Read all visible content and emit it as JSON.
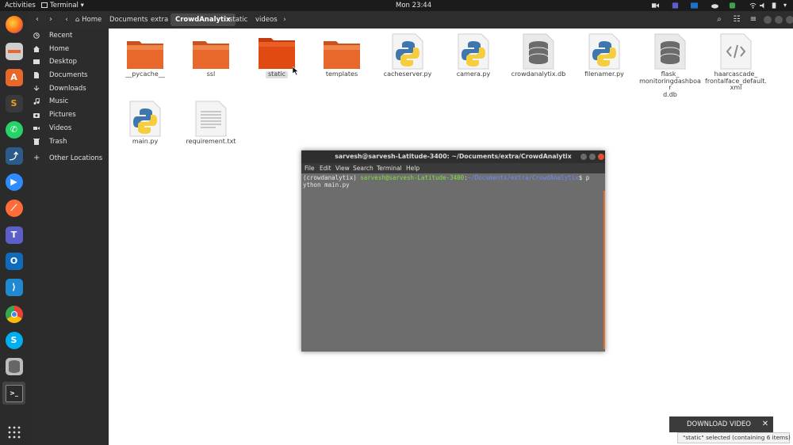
{
  "topbar": {
    "activities": "Activities",
    "app_menu": "Terminal",
    "clock": "Mon 23:44"
  },
  "files": {
    "breadcrumb": [
      "Home",
      "Documents",
      "extra",
      "CrowdAnalytix",
      "static",
      "videos"
    ],
    "sidebar": [
      "Recent",
      "Home",
      "Desktop",
      "Documents",
      "Downloads",
      "Music",
      "Pictures",
      "Videos",
      "Trash",
      "Other Locations"
    ],
    "items": [
      {
        "name": "__pycache__",
        "type": "folder"
      },
      {
        "name": "ssl",
        "type": "folder"
      },
      {
        "name": "static",
        "type": "folder"
      },
      {
        "name": "templates",
        "type": "folder"
      },
      {
        "name": "cacheserver.py",
        "type": "python"
      },
      {
        "name": "camera.py",
        "type": "python"
      },
      {
        "name": "crowdanalytix.db",
        "type": "db"
      },
      {
        "name": "filenamer.py",
        "type": "python"
      },
      {
        "name": "flask_",
        "name2": "monitoringdashboar",
        "name3": "d.db",
        "type": "db"
      },
      {
        "name": "haarcascade_",
        "name2": "frontalface_default.",
        "name3": "xml",
        "type": "xml"
      },
      {
        "name": "main.py",
        "type": "python"
      },
      {
        "name": "requirement.txt",
        "type": "text"
      }
    ],
    "status": "\"static\" selected  (containing 6 items)"
  },
  "terminal": {
    "title": "sarvesh@sarvesh-Latitude-3400: ~/Documents/extra/CrowdAnalytix",
    "menu": [
      "File",
      "Edit",
      "View",
      "Search",
      "Terminal",
      "Help"
    ],
    "env": "(crowdanalytix)",
    "user_host": "sarvesh@sarvesh-Latitude-3400",
    "path": "~/Documents/extra/CrowdAnalytix",
    "prompt_end": "$ p",
    "line2": "ython main.py"
  },
  "notification": {
    "label": "DOWNLOAD VIDEO",
    "close": "✕"
  },
  "colors": {
    "folder": "#e8672b",
    "folder_selected": "#e24a14",
    "terminal_bg": "#6d6d6d",
    "prompt_green": "#7ee23d",
    "prompt_blue": "#6f8cff",
    "accent": "#e2702f"
  }
}
